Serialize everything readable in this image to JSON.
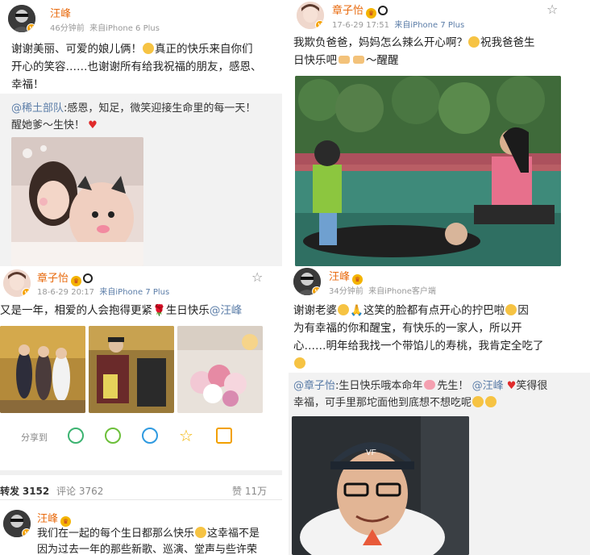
{
  "left": {
    "post1": {
      "user": "汪峰",
      "meta_time": "46分钟前",
      "meta_source": "来自iPhone 6 Plus",
      "text_line1": "谢谢美丽、可爱的娘儿俩！",
      "text_line1b": "真正的快乐来自你们",
      "text_line2": "开心的笑容……也谢谢所有给我祝福的朋友，感恩、",
      "text_line3": "幸福！",
      "repost_at": "@稀土部队",
      "repost_line1": ":感恩，知足，微笑迎接生命里的每一天！",
      "repost_line2": "醒她爹～生快！"
    },
    "post2": {
      "user": "章子怡",
      "meta_time": "18-6-29 20:17",
      "meta_source": "来自iPhone 7 Plus",
      "text_main": "又是一年，相爱的人会抱得更紧",
      "text_main2": "生日快乐",
      "text_at": "@汪峰",
      "share_label": "分享到"
    },
    "stats": {
      "repost_label": "转发",
      "repost_count": "3152",
      "comment_label": "评论",
      "comment_count": "3762",
      "like_label": "赞",
      "like_count": "11万"
    },
    "post3": {
      "user": "汪峰",
      "text_line1": "我们在一起的每个生日都那么快乐",
      "text_line1b": "这幸福不是",
      "text_line2": "因为过去一年的那些新歌、巡演、堂声与些许荣"
    }
  },
  "right": {
    "post1": {
      "user": "章子怡",
      "meta_time": "17-6-29 17:51",
      "meta_source": "来自iPhone 7 Plus",
      "text_line1": "我欺负爸爸，妈妈怎么辣么开心啊？",
      "text_line1b": "祝我爸爸生",
      "text_line2": "日快乐吧",
      "text_line2b": "～醒醒"
    },
    "post2": {
      "user": "汪峰",
      "meta_time": "34分钟前",
      "meta_source": "来自iPhone客户端",
      "text_line1": "谢谢老婆",
      "text_line1b": "这笑的脸都有点开心的拧巴啦",
      "text_line1c": "因",
      "text_line2": "为有幸福的你和醒宝，有快乐的一家人，所以开",
      "text_line3": "心……明年给我找一个带馅儿的寿桃，我肯定全吃了",
      "repost_at": "@章子怡",
      "repost_line1": ":生日快乐哦本命年",
      "repost_line1b": "先生！",
      "repost_at2": "@汪峰",
      "repost_line1c": "笑得很",
      "repost_line2": "幸福，可手里那坨面他到底想不想吃呢"
    }
  },
  "colors": {
    "name_orange": "#e86b0f",
    "link_blue": "#5b7da8",
    "meta_gray": "#999999",
    "repost_bg": "#f2f2f2"
  },
  "icons": [
    "star-icon",
    "wechat-icon",
    "moments-icon",
    "qq-icon",
    "qzone-icon",
    "export-icon"
  ]
}
